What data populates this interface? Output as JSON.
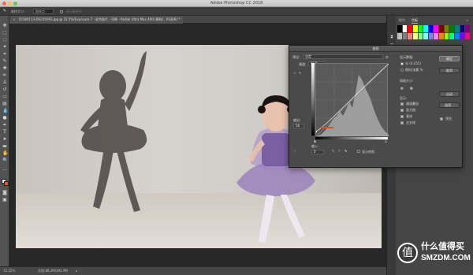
{
  "app": {
    "title": "Adobe Photoshop CC 2018"
  },
  "options_bar": {
    "items": [
      {
        "label": "取样大小:"
      },
      {
        "value": "取样点"
      },
      {
        "label": "显示取样环"
      }
    ]
  },
  "document": {
    "tab_label": "20180113-DSC05093.jpg @ 32.5%(Exposure 7 - 彩色胶片 - 印刷 - Kodak Ultra Max 400 (模拟) , RGB/8) *"
  },
  "status_bar": {
    "zoom": "32.52%",
    "doc_info": "文档:88.2M/395.9M"
  },
  "panel": {
    "tabs": [
      {
        "label": "颜色"
      },
      {
        "label": "色板"
      }
    ],
    "active_tab": 1
  },
  "swatch_colors": [
    "#000000",
    "#ffffff",
    "#ff0000",
    "#ffff00",
    "#00ff00",
    "#00ffff",
    "#0000ff",
    "#ff00ff",
    "#800000",
    "#808000",
    "#008000",
    "#008080",
    "#000080",
    "#800080",
    "#c0c0c0",
    "#808080",
    "#ff8080",
    "#ffff80",
    "#80ff80",
    "#80ffff",
    "#8080ff",
    "#ff80ff",
    "#ff8000",
    "#80ff00",
    "#00ff80",
    "#0080ff",
    "#8000ff",
    "#ff0080"
  ],
  "curves_dialog": {
    "title": "曲线",
    "preset_label": "预设:",
    "preset_value": "自定",
    "channel_label": "通道:",
    "channel_value": "RGB",
    "output_label": "输出:",
    "output_value": "58",
    "input_label": "输入:",
    "input_value": "0",
    "show_clipping": "显示修剪",
    "display_amount_title": "显示数量:",
    "display_light": "光 (0-255)",
    "display_pigment": "颜料/油墨 %",
    "grid_size_title": "网格大小:",
    "show_title": "显示:",
    "show_channel_overlays": "通道叠加",
    "show_histogram": "直方图",
    "show_baseline": "基线",
    "show_intersection": "交叉线",
    "buttons": {
      "ok": "确定",
      "cancel": "取消",
      "auto": "自动",
      "options": "选项..."
    },
    "preview_label": "预览"
  },
  "watermark": {
    "badge_glyph": "值",
    "line1": "什么值得买",
    "line2": "SMZDM.COM"
  }
}
